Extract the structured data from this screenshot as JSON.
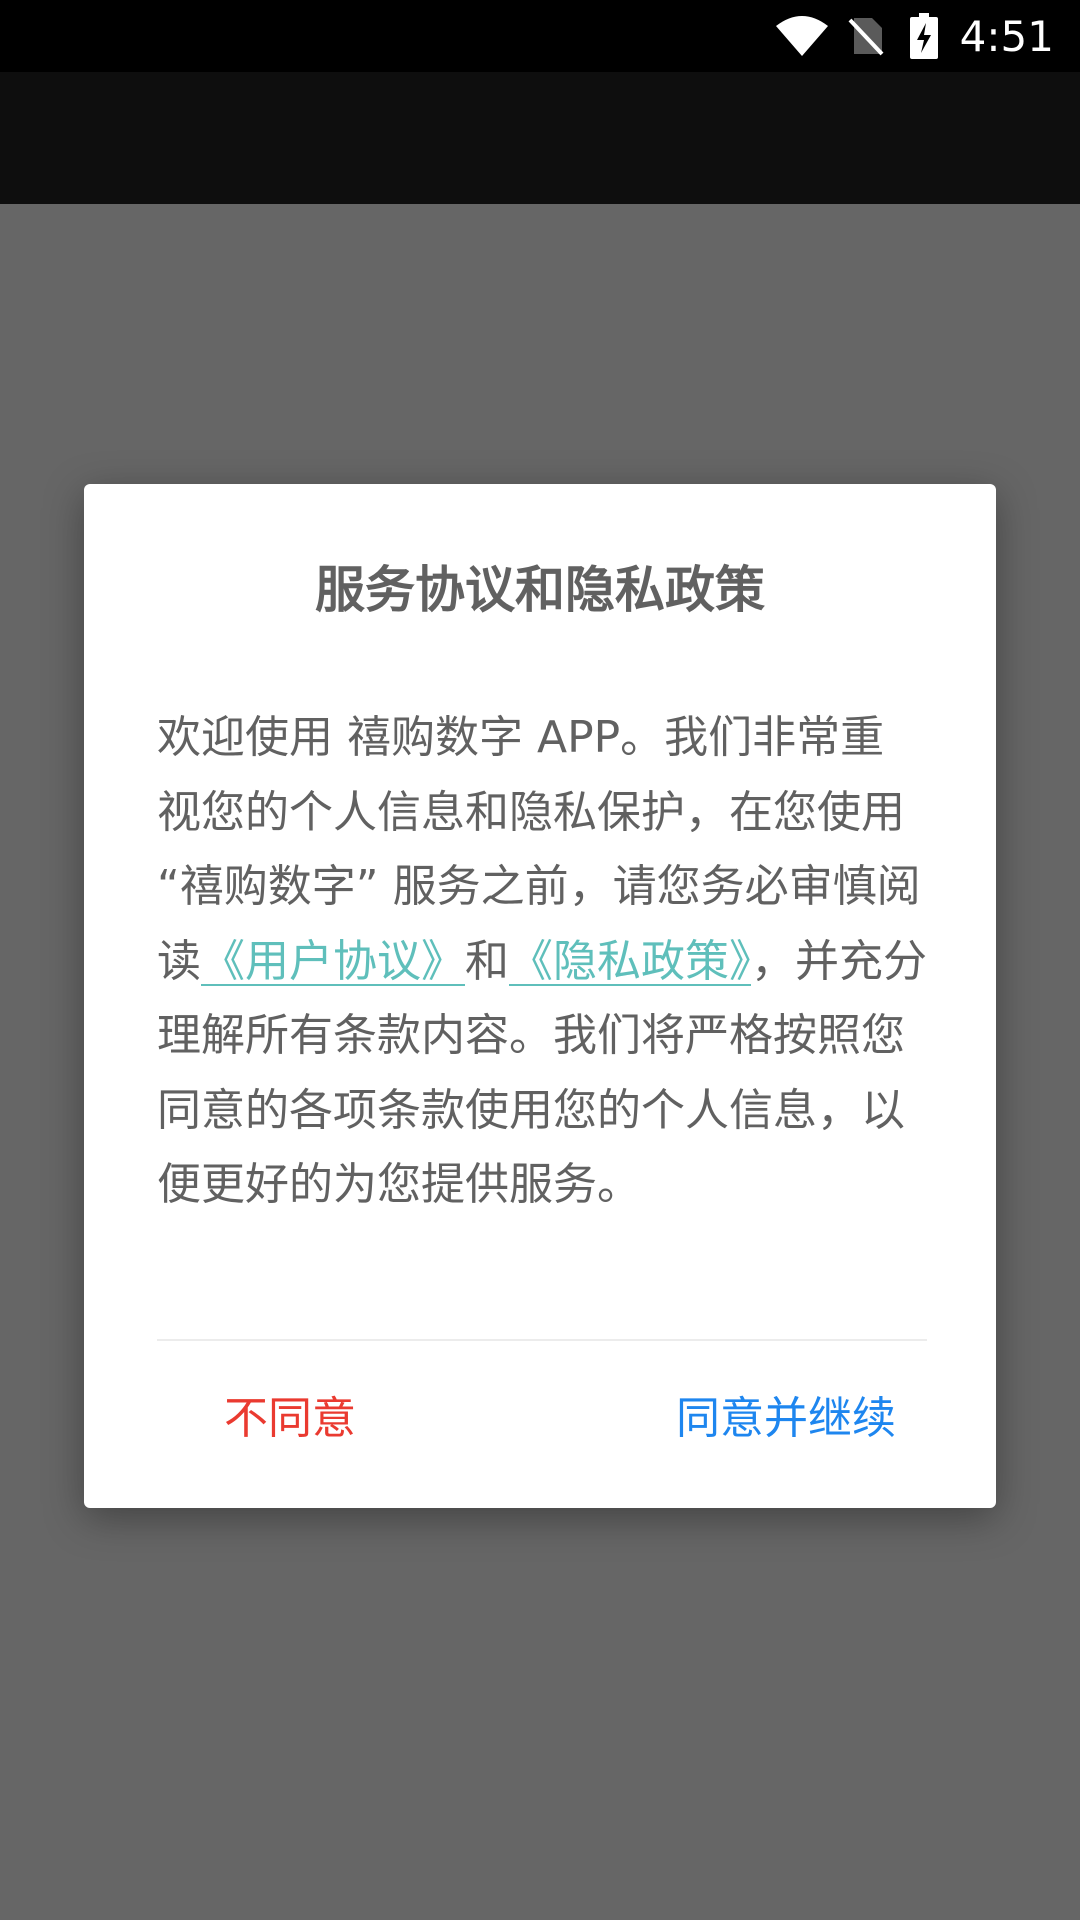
{
  "status_bar": {
    "time": "4:51",
    "icons": [
      "wifi-icon",
      "no-sim-icon",
      "battery-charging-icon"
    ]
  },
  "dialog": {
    "title": "服务协议和隐私政策",
    "body": {
      "part1": "欢迎使用 禧购数字 APP。我们非常重视您的个人信息和隐私保护，在您使用 “禧购数字” 服务之前，请您务必审慎阅读",
      "user_agreement_link": "《用户协议》",
      "and": "和",
      "privacy_policy_link": "《隐私政策》",
      "part2": "，并充分理解所有条款内容。我们将严格按照您同意的各项条款使用您的个人信息，以便更好的为您提供服务。"
    },
    "buttons": {
      "disagree": "不同意",
      "agree": "同意并继续"
    }
  },
  "colors": {
    "overlay": "#666666",
    "link": "#5fbfbb",
    "disagree": "#ea3a30",
    "agree": "#1e86ef",
    "text": "#616161"
  }
}
